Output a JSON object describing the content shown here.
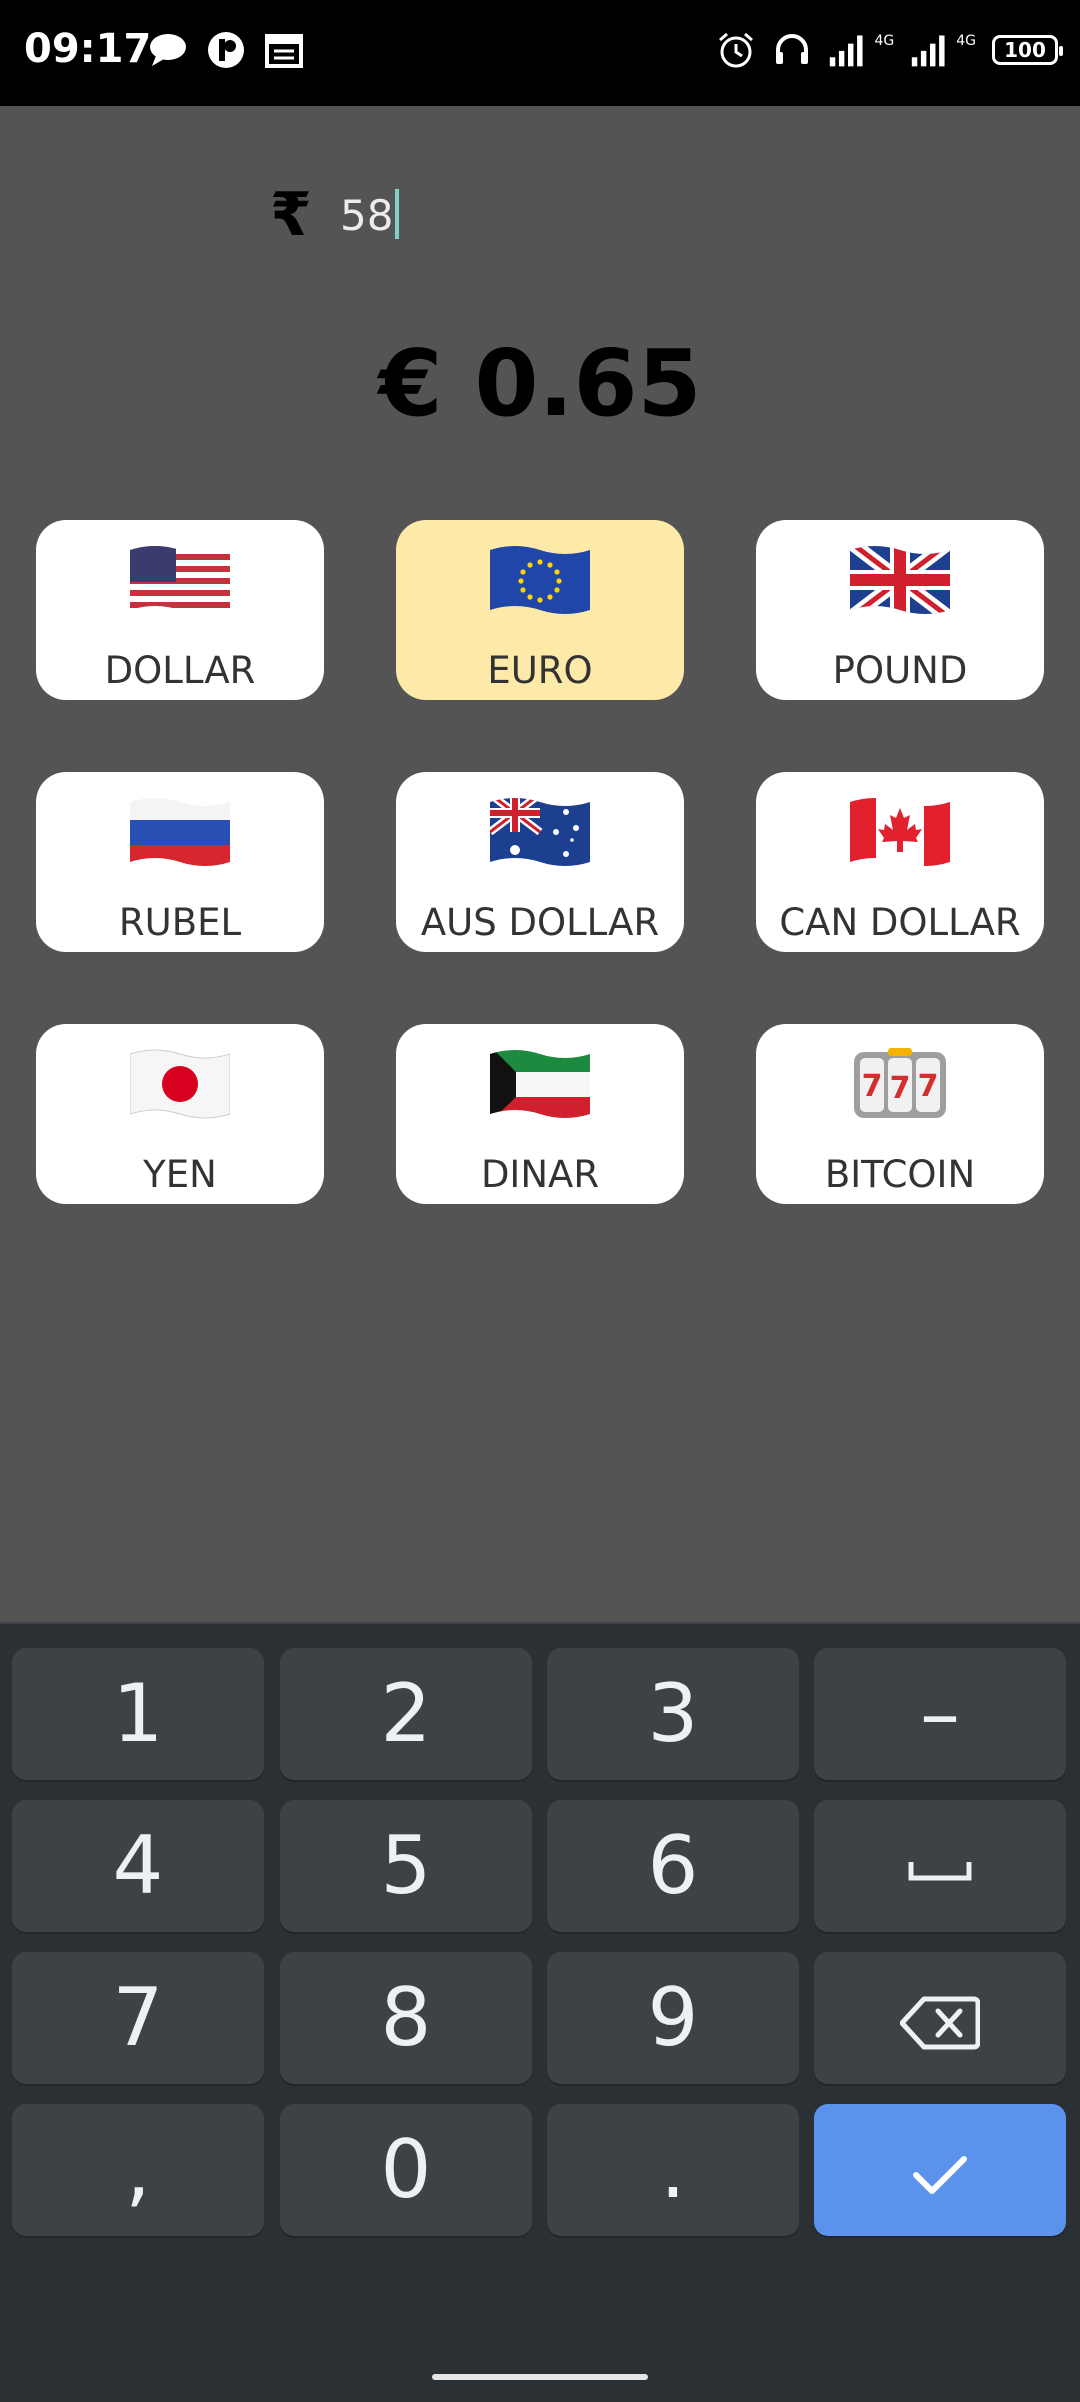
{
  "status_bar": {
    "time": "09:17",
    "network_label": "4G",
    "battery": "100",
    "left_icons": [
      "chat-icon",
      "app-icon",
      "calendar-icon"
    ],
    "right_icons": [
      "alarm-icon",
      "headset-icon",
      "signal-icon",
      "signal-icon",
      "battery-icon"
    ]
  },
  "converter": {
    "source_symbol": "₹",
    "amount": "58",
    "result": "€ 0.65"
  },
  "currencies": [
    {
      "label": "DOLLAR",
      "flag": "us-flag-icon",
      "selected": false
    },
    {
      "label": "EURO",
      "flag": "eu-flag-icon",
      "selected": true
    },
    {
      "label": "POUND",
      "flag": "uk-flag-icon",
      "selected": false
    },
    {
      "label": "RUBEL",
      "flag": "russia-flag-icon",
      "selected": false
    },
    {
      "label": "AUS DOLLAR",
      "flag": "australia-flag-icon",
      "selected": false
    },
    {
      "label": "CAN DOLLAR",
      "flag": "canada-flag-icon",
      "selected": false
    },
    {
      "label": "YEN",
      "flag": "japan-flag-icon",
      "selected": false
    },
    {
      "label": "DINAR",
      "flag": "kuwait-flag-icon",
      "selected": false
    },
    {
      "label": "BITCOIN",
      "flag": "slot-machine-icon",
      "selected": false
    }
  ],
  "colors": {
    "background": "#545454",
    "card": "#ffffff",
    "selected_card": "#fdeaa8",
    "keyboard": "#2b3034",
    "key": "#3d4246",
    "enter_key": "#5b93ec"
  },
  "keyboard": {
    "keys": [
      "1",
      "2",
      "3",
      "–",
      "4",
      "5",
      "6",
      "space",
      "7",
      "8",
      "9",
      "backspace",
      ",",
      "0",
      ".",
      "done"
    ],
    "key_icons": {
      "space": "space-icon",
      "backspace": "backspace-icon",
      "done": "check-icon"
    }
  }
}
